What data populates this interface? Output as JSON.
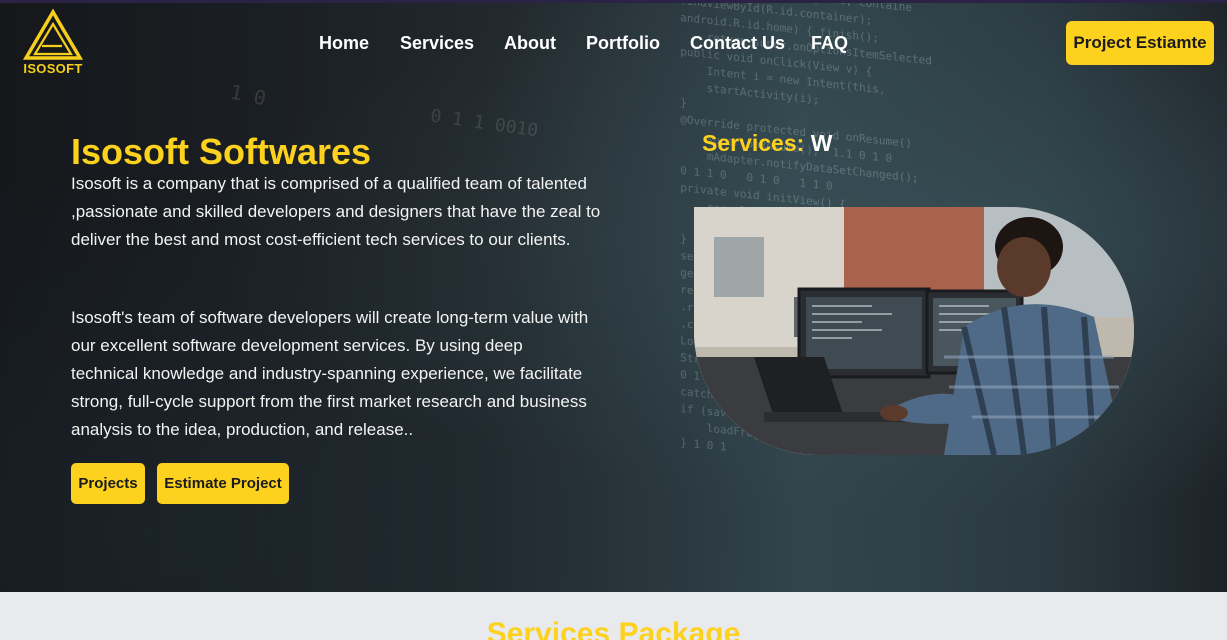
{
  "brand": {
    "name": "ISOSOFT",
    "accent": "#fcd21e"
  },
  "nav": {
    "items": [
      {
        "label": "Home"
      },
      {
        "label": "Services"
      },
      {
        "label": "About"
      },
      {
        "label": "Portfolio"
      },
      {
        "label": "Contact Us"
      },
      {
        "label": "FAQ"
      }
    ],
    "cta_label": "Project Estiamte"
  },
  "hero": {
    "title": "Isosoft Softwares",
    "paragraph1": "Isosoft is a company that is comprised of a qualified team of talented ,passionate and skilled developers and designers that have the zeal to deliver the best and most cost-efficient tech services to our clients.",
    "paragraph2": "Isosoft's team of software developers will create long-term value with our excellent software development services. By using deep technical knowledge and industry-spanning experience, we facilitate strong, full-cycle support from the first market research and business analysis to the idea, production, and release..",
    "projects_button": "Projects",
    "estimate_button": "Estimate Project",
    "services_label": "Services:",
    "services_typed": "W"
  },
  "section2": {
    "title": "Services Package"
  }
}
